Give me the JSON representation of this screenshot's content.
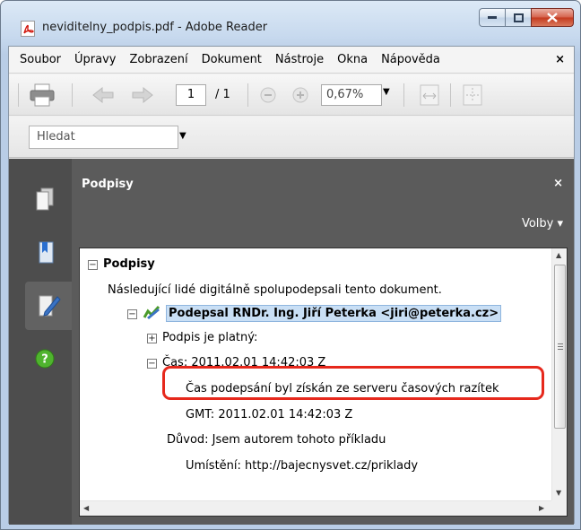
{
  "window": {
    "title": "neviditelny_podpis.pdf - Adobe Reader"
  },
  "menu": {
    "items": [
      "Soubor",
      "Úpravy",
      "Zobrazení",
      "Dokument",
      "Nástroje",
      "Okna",
      "Nápověda"
    ],
    "close_glyph": "×"
  },
  "toolbar": {
    "page_current": "1",
    "page_total": "/ 1",
    "zoom": "0,67%"
  },
  "find": {
    "placeholder": "Hledat"
  },
  "panel": {
    "title": "Podpisy",
    "close_glyph": "×",
    "options_label": "Volby ▾"
  },
  "tree": {
    "root_label": "Podpisy",
    "intro_text": "Následující lidé digitálně spolupodepsali tento dokument.",
    "signer_label": "Podepsal RNDr. Ing. Jiří Peterka <jiri@peterka.cz>",
    "validity_label": "Podpis je platný:",
    "time_label": "Čas: 2011.02.01 14:42:03 Z",
    "timestamp_note": "Čas podepsání byl získán ze serveru časových razítek",
    "gmt_label": "GMT: 2011.02.01 14:42:03 Z",
    "reason_label": "Důvod: Jsem autorem tohoto příkladu",
    "location_label": "Umístění: http://bajecnysvet.cz/priklady"
  },
  "icons": {
    "pdf": "pdf-file-icon",
    "print": "printer-icon",
    "prev": "previous-page-icon",
    "next": "next-page-icon",
    "zoom_out": "zoom-out-icon",
    "zoom_in": "zoom-in-icon",
    "fit_width": "fit-width-icon",
    "fit_page": "fit-page-icon",
    "pages": "pages-icon",
    "bookmarks": "bookmarks-icon",
    "signatures": "signatures-pen-icon",
    "help": "help-icon",
    "signature_valid": "signature-valid-icon"
  },
  "colors": {
    "highlight_ring": "#e6281c",
    "selection": "#c9dff5",
    "panel_bg": "#5b5b5b"
  }
}
